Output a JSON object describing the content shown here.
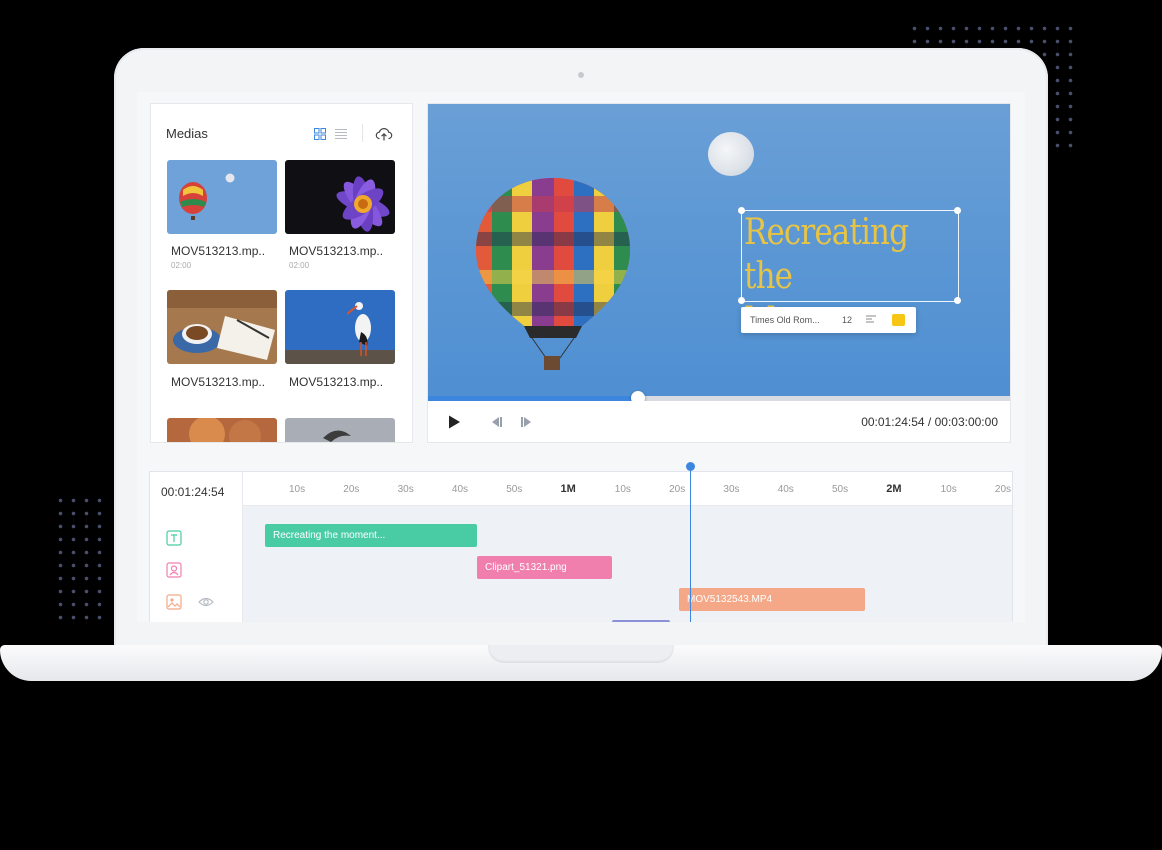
{
  "colors": {
    "accent": "#3d86e0",
    "overlay_text": "#e8c445",
    "clip_text": "#49cca4",
    "clip_clipart": "#f17fae",
    "clip_video": "#f5a887",
    "clip_audio": "#8b90d8",
    "swatch": "#f7c513"
  },
  "media_panel": {
    "title": "Medias",
    "view_grid_icon": "grid-icon",
    "view_list_icon": "list-icon",
    "upload_icon": "cloud-upload-icon",
    "items": [
      {
        "name": "MOV513213.mp..",
        "duration": "02:00",
        "subject": "hot-air-balloon"
      },
      {
        "name": "MOV513213.mp..",
        "duration": "02:00",
        "subject": "purple-flower"
      },
      {
        "name": "MOV513213.mp..",
        "duration": "",
        "subject": "coffee-notebook"
      },
      {
        "name": "MOV513213.mp..",
        "duration": "",
        "subject": "stork"
      },
      {
        "name": "",
        "duration": "",
        "subject": "autumn-tree"
      },
      {
        "name": "",
        "duration": "",
        "subject": "bird-sky"
      }
    ]
  },
  "preview": {
    "overlay_text_line1": "Recreating",
    "overlay_text_line2": "the Moment...",
    "text_toolbar": {
      "font": "Times Old Rom...",
      "size": "12",
      "align_icon": "align-left-icon",
      "color_swatch": "#f7c513"
    },
    "progress_fraction": 0.36,
    "current_time": "00:01:24:54",
    "total_time": "00:03:00:00",
    "time_display": "00:01:24:54 / 00:03:00:00",
    "controls": [
      "play-icon",
      "previous-frame-icon",
      "next-frame-icon"
    ]
  },
  "timeline": {
    "current_time": "00:01:24:54",
    "ruler": [
      "10s",
      "20s",
      "30s",
      "40s",
      "50s",
      "1M",
      "10s",
      "20s",
      "30s",
      "40s",
      "50s",
      "2M",
      "10s",
      "20s"
    ],
    "major_ticks": [
      "1M",
      "2M"
    ],
    "tracks": [
      {
        "icon": "text-track-icon",
        "clip": "Recreating the moment..."
      },
      {
        "icon": "clipart-track-icon",
        "clip": "Clipart_51321.png"
      },
      {
        "icon": "image-track-icon",
        "visibility_icon": "eye-icon",
        "clip": "MOV5132543.MP4"
      }
    ]
  }
}
